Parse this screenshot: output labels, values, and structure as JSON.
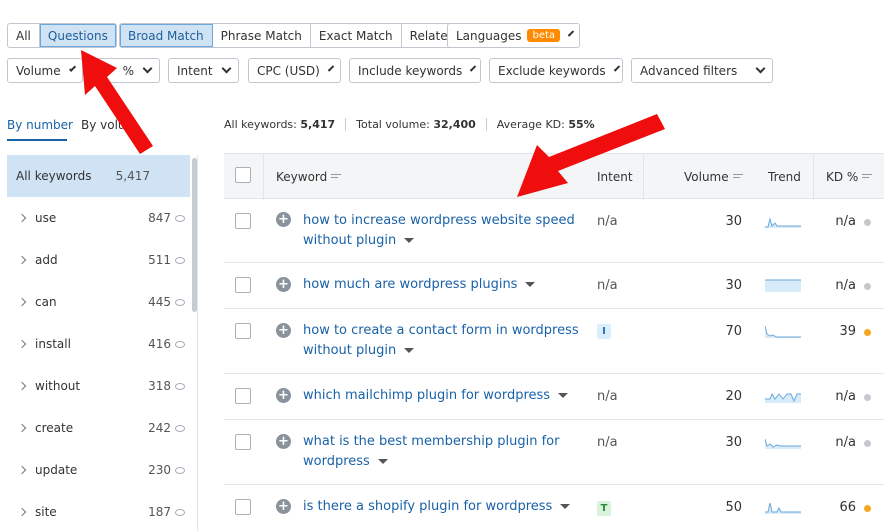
{
  "filters": {
    "match_tabs": [
      "All",
      "Questions"
    ],
    "match_types": [
      "Broad Match",
      "Phrase Match",
      "Exact Match",
      "Related"
    ],
    "languages": "Languages",
    "beta": "beta",
    "volume": "Volume",
    "kd": "%",
    "intent": "Intent",
    "cpc": "CPC (USD)",
    "include": "Include keywords",
    "exclude": "Exclude keywords",
    "advanced": "Advanced filters"
  },
  "side_tabs": [
    "By number",
    "By volu"
  ],
  "sidebar": [
    {
      "label": "All keywords",
      "count": "5,417"
    },
    {
      "label": "use",
      "count": "847"
    },
    {
      "label": "add",
      "count": "511"
    },
    {
      "label": "can",
      "count": "445"
    },
    {
      "label": "install",
      "count": "416"
    },
    {
      "label": "without",
      "count": "318"
    },
    {
      "label": "create",
      "count": "242"
    },
    {
      "label": "update",
      "count": "230"
    },
    {
      "label": "site",
      "count": "187"
    }
  ],
  "stats": {
    "all_label": "All keywords:",
    "all_value": "5,417",
    "vol_label": "Total volume:",
    "vol_value": "32,400",
    "kd_label": "Average KD:",
    "kd_value": "55%"
  },
  "columns": [
    "Keyword",
    "Intent",
    "Volume",
    "Trend",
    "KD %"
  ],
  "rows": [
    {
      "keyword": "how to increase wordpress website speed without plugin",
      "intent": "n/a",
      "volume": "30",
      "kd": "n/a",
      "dot": "#c5c9ce"
    },
    {
      "keyword": "how much are wordpress plugins",
      "intent": "n/a",
      "volume": "30",
      "kd": "n/a",
      "dot": "#c5c9ce"
    },
    {
      "keyword": "how to create a contact form in wordpress without plugin",
      "intent": "I",
      "volume": "70",
      "kd": "39",
      "dot": "#f5a623"
    },
    {
      "keyword": "which mailchimp plugin for wordpress",
      "intent": "n/a",
      "volume": "20",
      "kd": "n/a",
      "dot": "#c5c9ce"
    },
    {
      "keyword": "what is the best membership plugin for wordpress",
      "intent": "n/a",
      "volume": "30",
      "kd": "n/a",
      "dot": "#c5c9ce"
    },
    {
      "keyword": "is there a shopify plugin for wordpress",
      "intent": "T",
      "volume": "50",
      "kd": "66",
      "dot": "#f5a623"
    }
  ]
}
